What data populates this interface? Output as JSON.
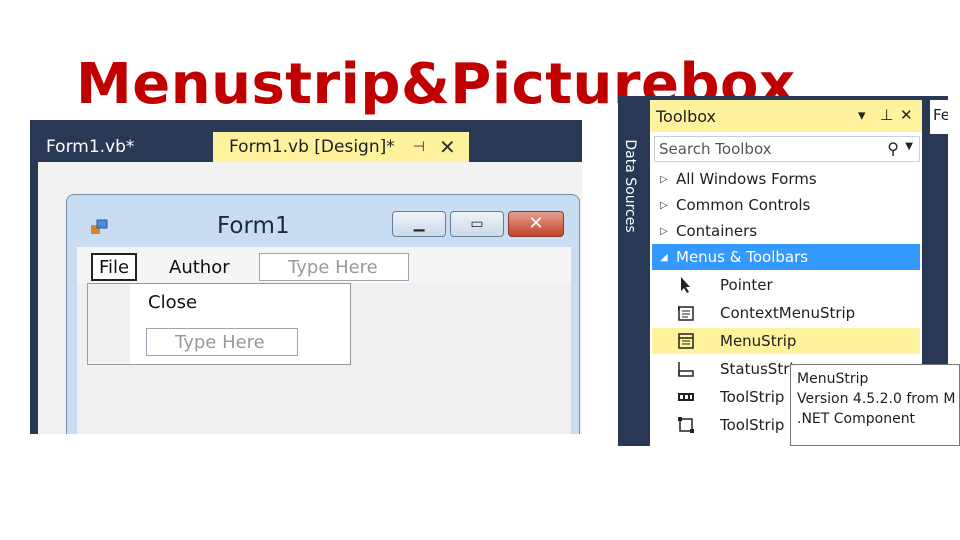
{
  "slide": {
    "title": "Menustrip&Picturebox"
  },
  "editor": {
    "tabs": [
      {
        "label": "Form1.vb*"
      },
      {
        "label": "Form1.vb [Design]*",
        "pin_icon": "pin-icon",
        "close_icon": "close-icon"
      }
    ],
    "form": {
      "title": "Form1",
      "menu": {
        "file": "File",
        "author": "Author",
        "type_here": "Type Here"
      },
      "dropdown": {
        "close": "Close",
        "type_here": "Type Here"
      }
    }
  },
  "toolbox": {
    "side_label": "Data Sources",
    "title": "Toolbox",
    "search_placeholder": "Search Toolbox",
    "categories": [
      {
        "label": "All Windows Forms"
      },
      {
        "label": "Common Controls"
      },
      {
        "label": "Containers"
      },
      {
        "label": "Menus & Toolbars"
      }
    ],
    "items": [
      {
        "label": "Pointer",
        "icon": "pointer-icon"
      },
      {
        "label": "ContextMenuStrip",
        "icon": "contextmenustrip-icon"
      },
      {
        "label": "MenuStrip",
        "icon": "menustrip-icon"
      },
      {
        "label": "StatusStri",
        "icon": "statusstrip-icon"
      },
      {
        "label": "ToolStrip",
        "icon": "toolstrip-icon"
      },
      {
        "label": "ToolStrip",
        "icon": "toolstripcontainer-icon"
      }
    ],
    "right_tab": "Fe",
    "tooltip": {
      "line1": "MenuStrip",
      "line2": "Version 4.5.2.0 from M",
      "line3": ".NET Component"
    }
  },
  "colors": {
    "title_red": "#c00000",
    "vs_dark": "#293955",
    "vs_tab_yellow": "#fff29d",
    "selection_blue": "#3399ff"
  }
}
